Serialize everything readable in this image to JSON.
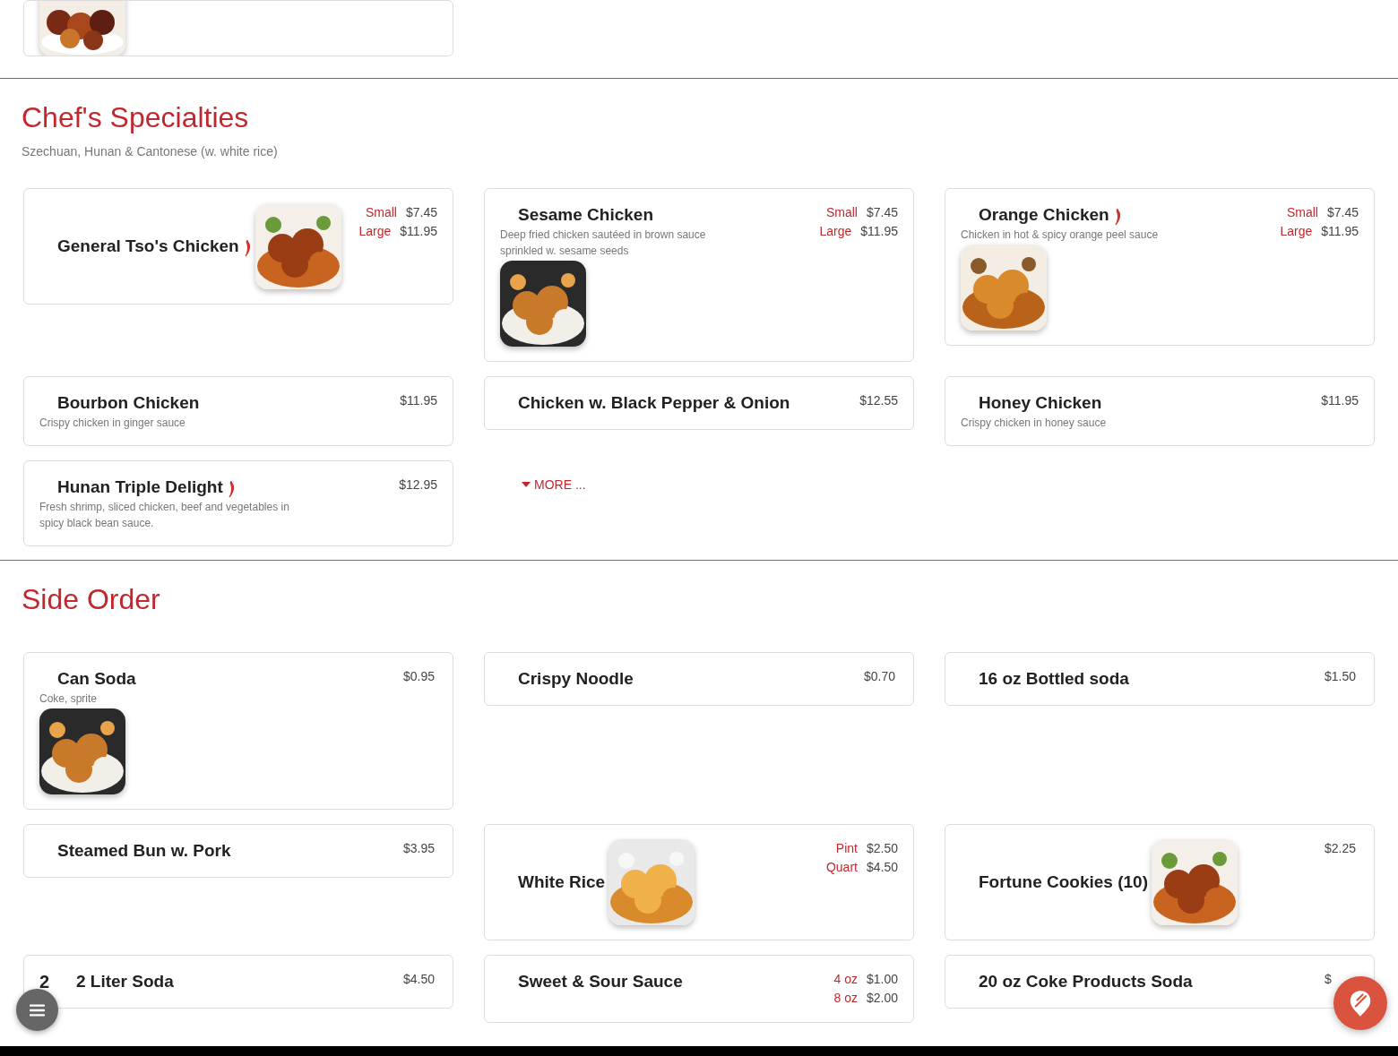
{
  "sections": [
    {
      "title": "Chef's Specialties",
      "subtitle": "Szechuan, Hunan & Cantonese (w. white rice)",
      "more_link": "MORE ...",
      "items": [
        {
          "kind": "beside",
          "name": "General Tso's Chicken",
          "spicy": true,
          "prices": [
            {
              "size": "Small",
              "price": "$7.45"
            },
            {
              "size": "Large",
              "price": "$11.95"
            }
          ]
        },
        {
          "kind": "below",
          "name": "Sesame Chicken",
          "description": "Deep fried chicken sautéed in brown sauce sprinkled w. sesame seeds",
          "spicy": false,
          "prices": [
            {
              "size": "Small",
              "price": "$7.45"
            },
            {
              "size": "Large",
              "price": "$11.95"
            }
          ]
        },
        {
          "kind": "below",
          "name": "Orange Chicken",
          "description": "Chicken in hot & spicy orange peel sauce",
          "spicy": true,
          "prices": [
            {
              "size": "Small",
              "price": "$7.45"
            },
            {
              "size": "Large",
              "price": "$11.95"
            }
          ]
        },
        {
          "name": "Bourbon Chicken",
          "description": "Crispy chicken in ginger sauce",
          "spicy": false,
          "prices": [
            {
              "price": "$11.95"
            }
          ]
        },
        {
          "name": "Chicken w. Black Pepper & Onion",
          "spicy": false,
          "prices": [
            {
              "price": "$12.55"
            }
          ]
        },
        {
          "name": "Honey Chicken",
          "description": "Crispy chicken in honey sauce",
          "spicy": false,
          "prices": [
            {
              "price": "$11.95"
            }
          ]
        },
        {
          "name": "Hunan Triple Delight",
          "description": "Fresh shrimp, sliced chicken, beef and vegetables in spicy black bean sauce.",
          "spicy": true,
          "prices": [
            {
              "price": "$12.95"
            }
          ]
        }
      ]
    },
    {
      "title": "Side Order",
      "items": [
        {
          "kind": "below",
          "name": "Can Soda",
          "description": "Coke, sprite",
          "spicy": false,
          "prices": [
            {
              "price": "$0.95"
            }
          ]
        },
        {
          "name": "Crispy Noodle",
          "spicy": false,
          "prices": [
            {
              "price": "$0.70"
            }
          ]
        },
        {
          "name": "16 oz Bottled soda",
          "spicy": false,
          "prices": [
            {
              "price": "$1.50"
            }
          ]
        },
        {
          "name": "Steamed Bun w. Pork",
          "spicy": false,
          "prices": [
            {
              "price": "$3.95"
            }
          ]
        },
        {
          "kind": "beside",
          "name": "White Rice",
          "spicy": false,
          "prices": [
            {
              "size": "Pint",
              "price": "$2.50"
            },
            {
              "size": "Quart",
              "price": "$4.50"
            }
          ]
        },
        {
          "kind": "beside",
          "name": "Fortune Cookies (10)",
          "spicy": false,
          "prices": [
            {
              "price": "$2.25"
            }
          ]
        },
        {
          "name": "2 Liter Soda",
          "number": "2",
          "spicy": false,
          "prices": [
            {
              "price": "$4.50"
            }
          ]
        },
        {
          "name": "Sweet & Sour Sauce",
          "spicy": false,
          "prices": [
            {
              "size": "4 oz",
              "price": "$1.00"
            },
            {
              "size": "8 oz",
              "price": "$2.00"
            }
          ]
        },
        {
          "name": "20 oz Coke Products Soda",
          "spicy": false,
          "prices": [
            {
              "price": "$"
            }
          ]
        }
      ]
    }
  ]
}
